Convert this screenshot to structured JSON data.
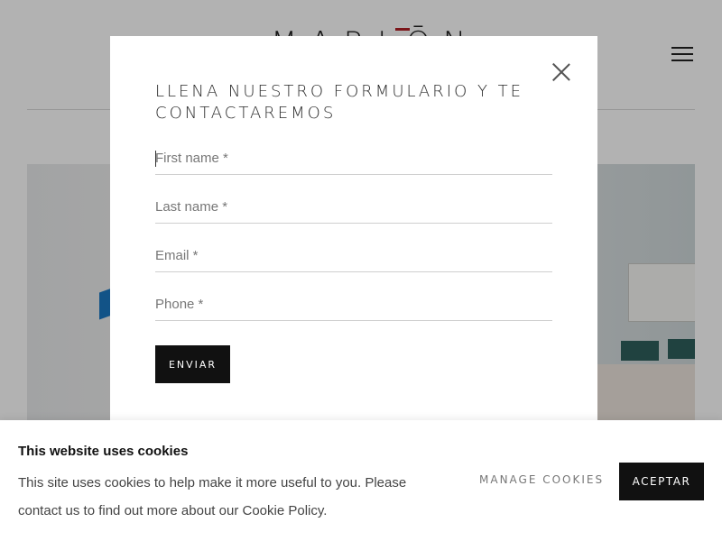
{
  "header": {
    "logo_text": "MARLŌN",
    "menu_icon": "hamburger-menu-icon"
  },
  "modal": {
    "title": "LLENA NUESTRO FORMULARIO Y TE CONTACTAREMOS",
    "close_icon": "close-icon",
    "fields": [
      {
        "placeholder": "First name *",
        "value": ""
      },
      {
        "placeholder": "Last name *",
        "value": ""
      },
      {
        "placeholder": "Email *",
        "value": ""
      },
      {
        "placeholder": "Phone *",
        "value": ""
      }
    ],
    "submit_label": "ENVIAR"
  },
  "cookie_banner": {
    "title": "This website uses cookies",
    "text": "This site uses cookies to help make it more useful to you. Please contact us to find out more about our Cookie Policy.",
    "manage_label": "MANAGE COOKIES",
    "accept_label": "ACEPTAR"
  },
  "colors": {
    "accent": "#b01f24",
    "button_dark": "#111111"
  }
}
